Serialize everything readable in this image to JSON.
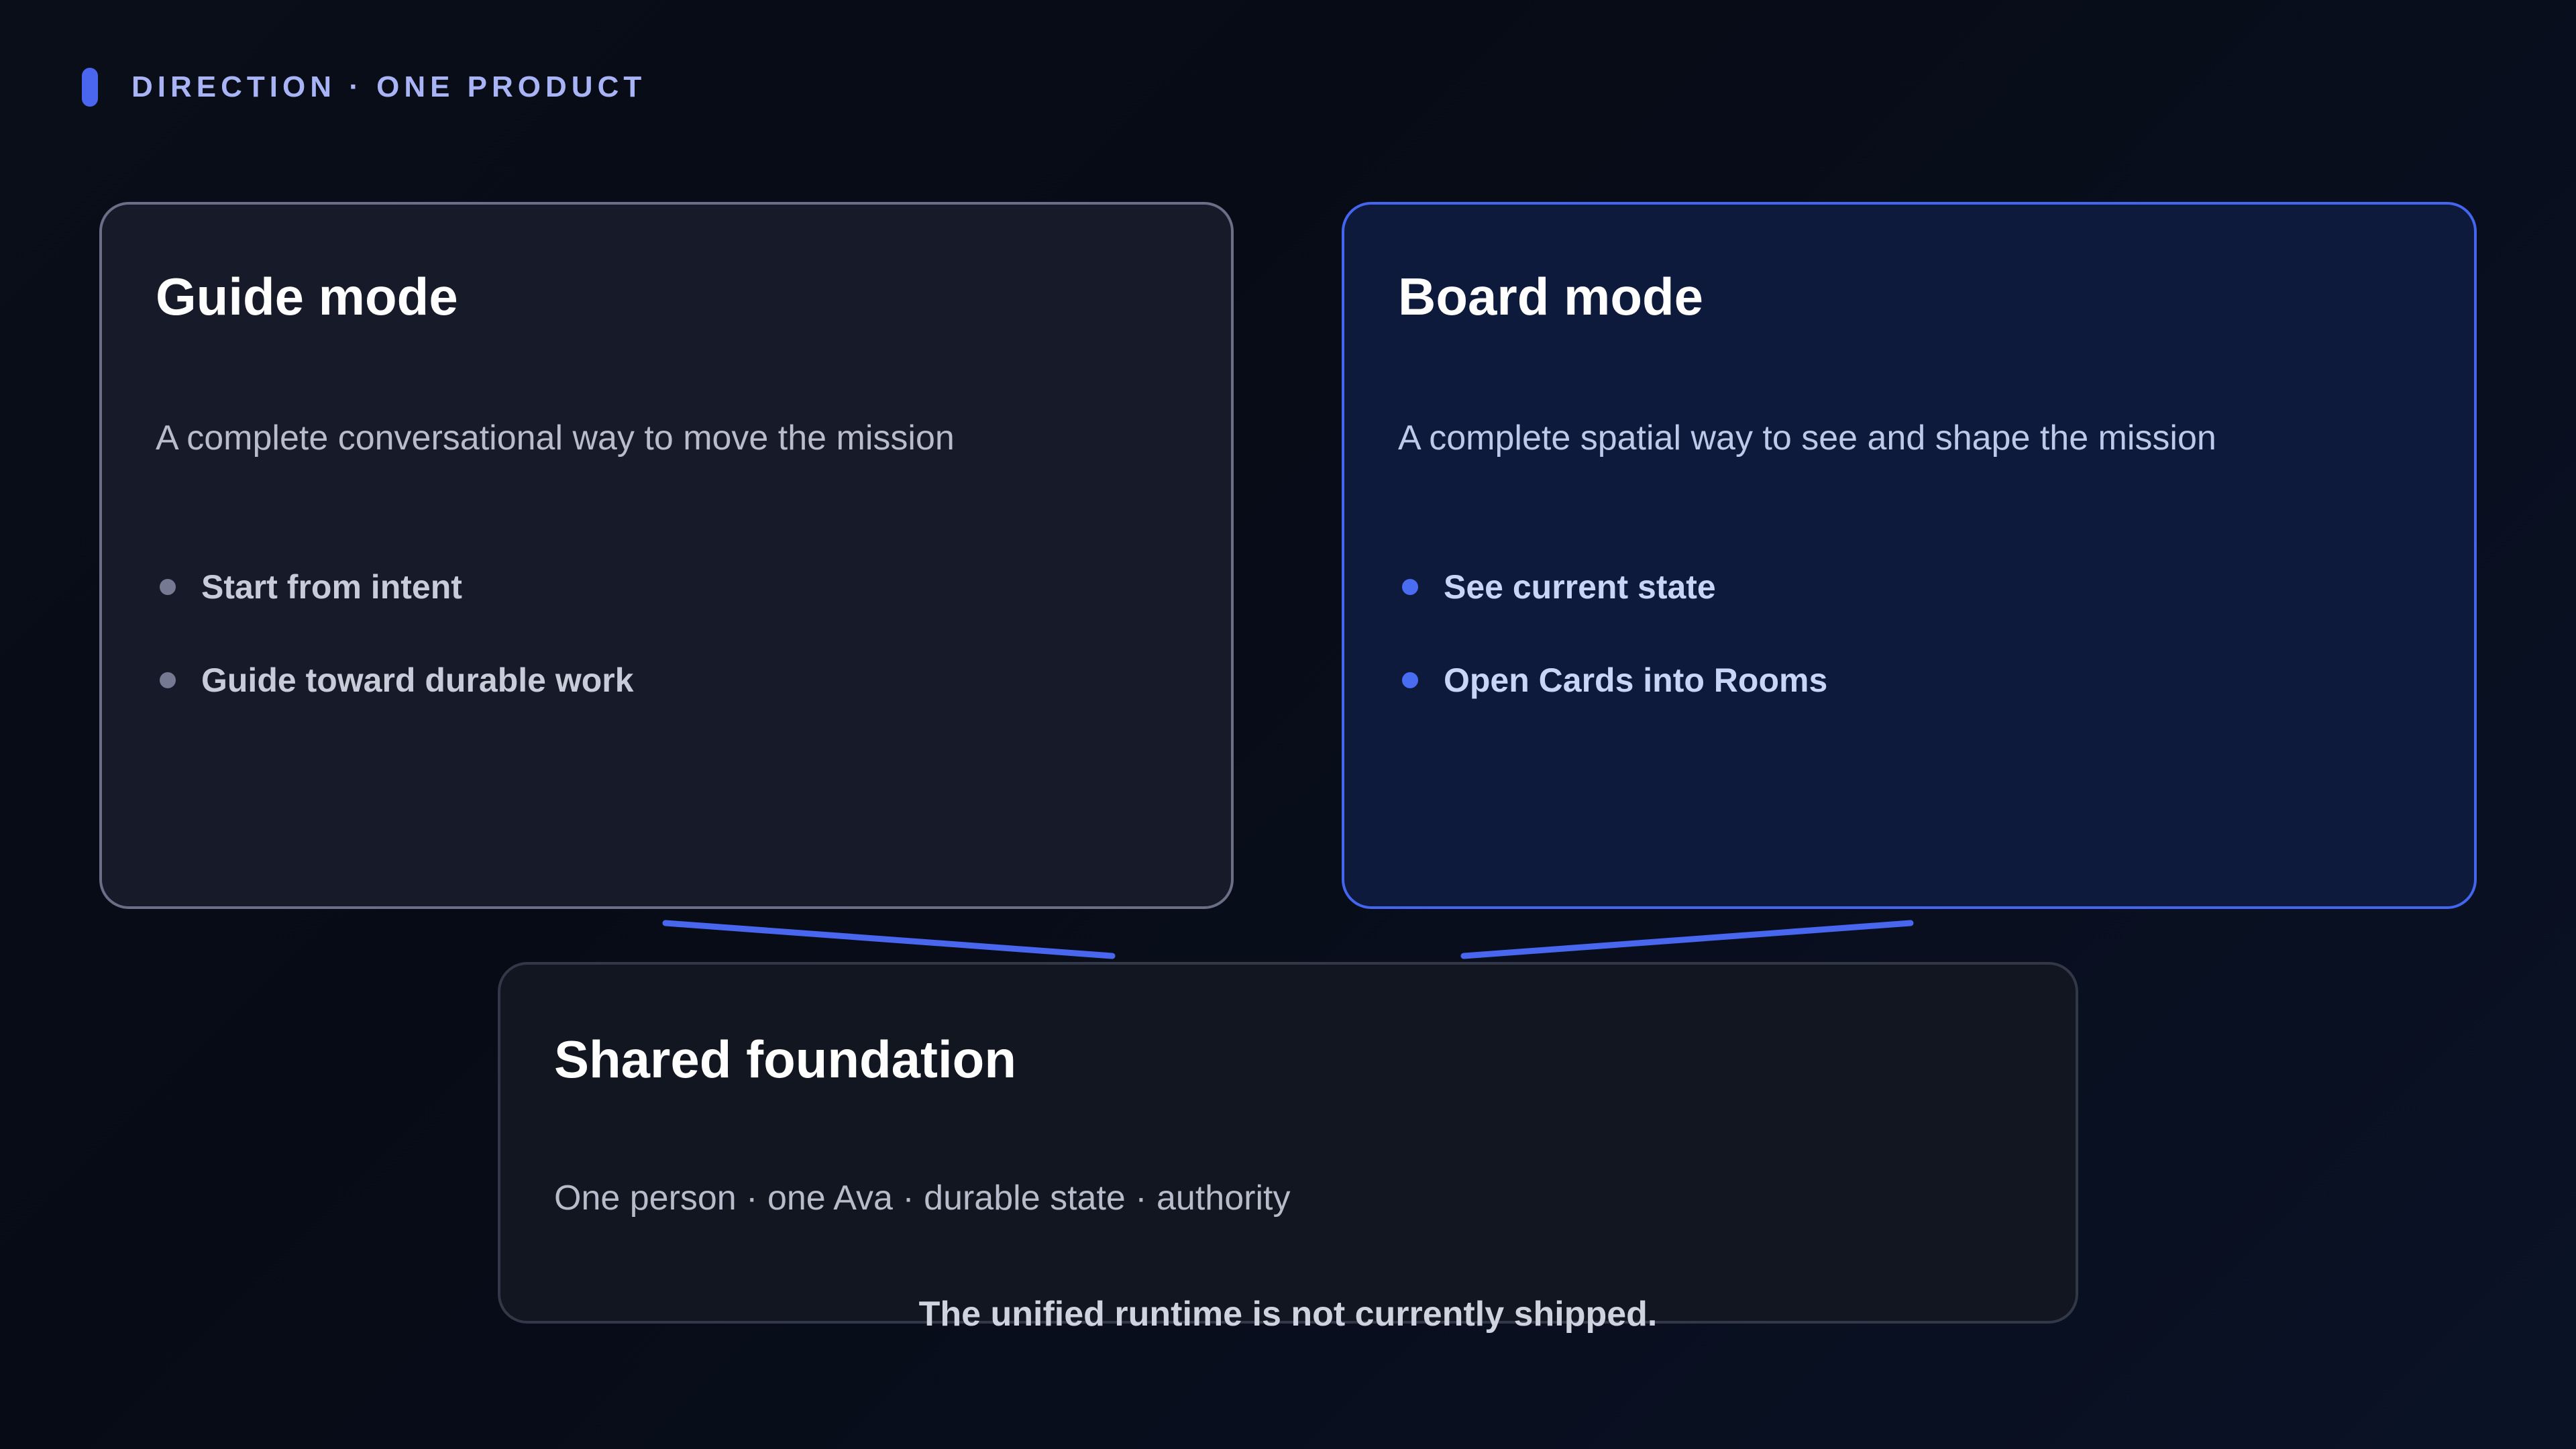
{
  "eyebrow": {
    "text": "DIRECTION · ONE PRODUCT"
  },
  "guide": {
    "title": "Guide mode",
    "description": "A complete conversational way to move the mission",
    "bullets": [
      "Start from intent",
      "Guide toward durable work"
    ]
  },
  "board": {
    "title": "Board mode",
    "description": "A complete spatial way to see and shape the mission",
    "bullets": [
      "See current state",
      "Open Cards into Rooms"
    ]
  },
  "shared": {
    "title": "Shared foundation",
    "description": "One person · one Ava · durable state · authority"
  },
  "footnote": "The unified runtime is not currently shipped.",
  "colors": {
    "accent": "#4a66ee",
    "guide_border": "#6a6f87",
    "board_border": "#4466ee"
  }
}
